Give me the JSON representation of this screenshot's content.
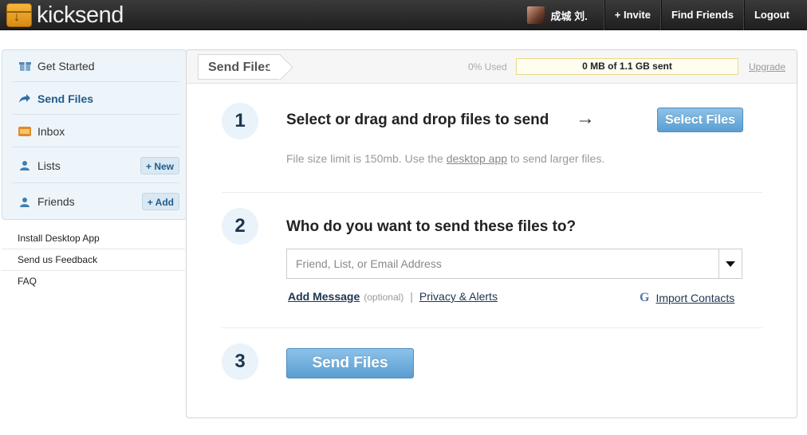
{
  "app": {
    "logo_text": "kicksend"
  },
  "topnav": {
    "user_name": "成城 刘.",
    "invite": "+ Invite",
    "find_friends": "Find Friends",
    "logout": "Logout"
  },
  "sidebar": {
    "items": [
      {
        "label": "Get Started",
        "icon": "gift-icon"
      },
      {
        "label": "Send Files",
        "icon": "send-arrow-icon",
        "active": true
      },
      {
        "label": "Inbox",
        "icon": "inbox-icon"
      },
      {
        "label": "Lists",
        "icon": "person-icon",
        "button": "+ New"
      },
      {
        "label": "Friends",
        "icon": "person-icon",
        "button": "+ Add"
      }
    ],
    "links": [
      "Install Desktop App",
      "Send us Feedback",
      "FAQ"
    ]
  },
  "main": {
    "tab": "Send Files",
    "used": "0% Used",
    "usage": "0 MB of 1.1 GB sent",
    "upgrade": "Upgrade",
    "steps": [
      {
        "number": "1",
        "title": "Select or drag and drop files to send",
        "arrow": "→",
        "button": "Select Files",
        "hint_before": "File size limit is 150mb. Use the ",
        "hint_link": "desktop app",
        "hint_after": " to send larger files."
      },
      {
        "number": "2",
        "title": "Who do you want to send these files to?",
        "input_placeholder": "Friend, List, or Email Address",
        "add_message": "Add Message",
        "optional": "(optional)",
        "separator": "|",
        "privacy": "Privacy & Alerts",
        "import_icon": "G",
        "import": "Import Contacts"
      },
      {
        "number": "3",
        "button": "Send Files"
      }
    ]
  },
  "colors": {
    "topbar": "#2a2a2a",
    "sidebar_bg": "#eef5fa",
    "accent_blue": "#5b9ed1",
    "dark_text": "#1d3550"
  }
}
